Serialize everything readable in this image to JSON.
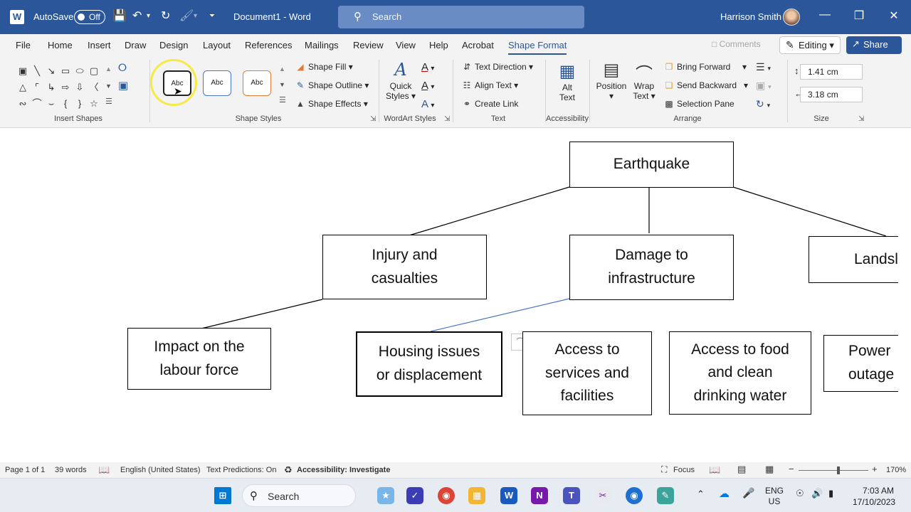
{
  "titlebar": {
    "autosave_label": "AutoSave",
    "autosave_state": "Off",
    "document_title": "Document1  -  Word",
    "search_placeholder": "Search",
    "user_name": "Harrison Smith"
  },
  "tabs": [
    "File",
    "Home",
    "Insert",
    "Draw",
    "Design",
    "Layout",
    "References",
    "Mailings",
    "Review",
    "View",
    "Help",
    "Acrobat",
    "Shape Format"
  ],
  "active_tab": "Shape Format",
  "actions": {
    "comments": "Comments",
    "editing": "Editing",
    "share": "Share"
  },
  "ribbon": {
    "insert_shapes": {
      "label": "Insert Shapes"
    },
    "shape_styles": {
      "label": "Shape Styles",
      "preset_text": "Abc",
      "shape_fill": "Shape Fill",
      "shape_outline": "Shape Outline",
      "shape_effects": "Shape Effects"
    },
    "wordart_styles": {
      "label": "WordArt Styles",
      "quick_styles_line1": "Quick",
      "quick_styles_line2": "Styles"
    },
    "text": {
      "label": "Text",
      "text_direction": "Text Direction",
      "align_text": "Align Text",
      "create_link": "Create Link"
    },
    "accessibility": {
      "label": "Accessibility",
      "alt_text_line1": "Alt",
      "alt_text_line2": "Text"
    },
    "arrange": {
      "label": "Arrange",
      "position": "Position",
      "wrap_text_line1": "Wrap",
      "wrap_text_line2": "Text",
      "bring_forward": "Bring Forward",
      "send_backward": "Send Backward",
      "selection_pane": "Selection Pane"
    },
    "size": {
      "label": "Size",
      "height": "1.41 cm",
      "width": "3.18 cm"
    }
  },
  "diagram": {
    "root": "Earthquake",
    "level1": [
      {
        "line1": "Injury and",
        "line2": "casualties"
      },
      {
        "line1": "Damage to",
        "line2": "infrastructure"
      },
      {
        "line1": "Landsl",
        "line2": ""
      }
    ],
    "level2": [
      {
        "line1": "Impact on the",
        "line2": "labour force",
        "line3": ""
      },
      {
        "line1": "Housing issues",
        "line2": "or displacement",
        "line3": ""
      },
      {
        "line1": "Access to",
        "line2": "services and",
        "line3": "facilities"
      },
      {
        "line1": "Access to food",
        "line2": "and clean",
        "line3": "drinking water"
      },
      {
        "line1": "Power",
        "line2": "outage",
        "line3": ""
      }
    ]
  },
  "statusbar": {
    "page": "Page 1 of 1",
    "words": "39 words",
    "language": "English (United States)",
    "text_predictions": "Text Predictions: On",
    "accessibility": "Accessibility: Investigate",
    "focus": "Focus",
    "zoom": "170%"
  },
  "taskbar": {
    "search_label": "Search",
    "lang_line1": "ENG",
    "lang_line2": "US",
    "time": "7:03 AM",
    "date": "17/10/2023"
  }
}
